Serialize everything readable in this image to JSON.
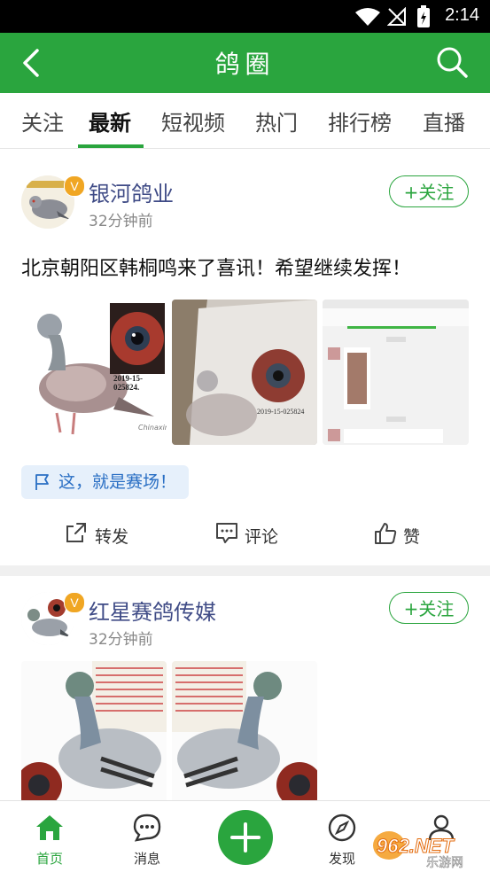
{
  "status_bar": {
    "time": "2:14"
  },
  "header": {
    "title": "鸽圈"
  },
  "tabs": [
    {
      "label": "关注"
    },
    {
      "label": "最新"
    },
    {
      "label": "短视频"
    },
    {
      "label": "热门"
    },
    {
      "label": "排行榜"
    },
    {
      "label": "直播"
    }
  ],
  "posts": [
    {
      "username": "银河鸽业",
      "time": "32分钟前",
      "follow_label": "+关注",
      "text": "北京朝阳区韩桐鸣来了喜讯！希望继续发挥！",
      "image1_caption": "2019-15-025824.",
      "image1_brand": "Chinaxin",
      "image2_caption": "2019-15-025824",
      "tag": "这，就是赛场！",
      "actions": {
        "share": "转发",
        "comment": "评论",
        "like": "赞"
      }
    },
    {
      "username": "红星赛鸽传媒",
      "time": "32分钟前",
      "follow_label": "+关注"
    }
  ],
  "bottom_nav": {
    "home": "首页",
    "messages": "消息",
    "discover": "发现"
  },
  "watermark": {
    "text": "962.NET",
    "sub": "乐游网"
  },
  "colors": {
    "brand_green": "#2aa53e",
    "username_blue": "#3f4b86",
    "tag_bg": "#e6f0fb",
    "badge_orange": "#f0a623"
  },
  "icons": [
    "back-icon",
    "search-icon",
    "share-icon",
    "comment-icon",
    "like-icon",
    "flag-icon",
    "home-icon",
    "message-icon",
    "add-icon",
    "compass-icon",
    "profile-icon"
  ]
}
